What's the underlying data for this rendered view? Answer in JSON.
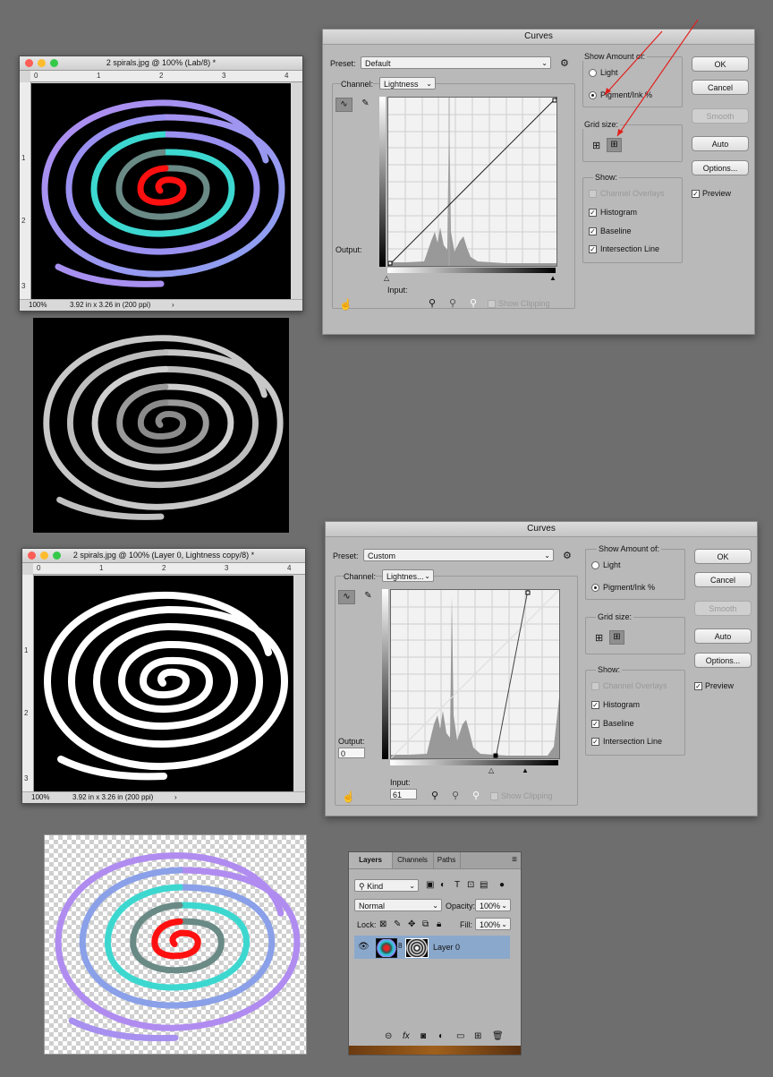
{
  "window1": {
    "title": "2 spirals.jpg @ 100% (Lab/8) *",
    "zoom": "100%",
    "doc_size": "3.92 in x 3.26 in (200 ppi)",
    "ruler_top": [
      "0",
      "1",
      "2",
      "3",
      "4"
    ],
    "ruler_left": [
      "1",
      "2",
      "3"
    ]
  },
  "window2": {
    "title": "2 spirals.jpg @ 100% (Layer 0, Lightness copy/8) *",
    "zoom": "100%",
    "doc_size": "3.92 in x 3.26 in (200 ppi)",
    "ruler_top": [
      "0",
      "1",
      "2",
      "3",
      "4"
    ],
    "ruler_left": [
      "1",
      "2",
      "3"
    ]
  },
  "curves1": {
    "title": "Curves",
    "preset_label": "Preset:",
    "preset_value": "Default",
    "channel_label": "Channel:",
    "channel_value": "Lightness",
    "output_label": "Output:",
    "input_label": "Input:",
    "show_clipping": "Show Clipping",
    "show_amount_label": "Show Amount of:",
    "light": "Light",
    "pigment": "Pigment/Ink %",
    "grid_size_label": "Grid size:",
    "show_label": "Show:",
    "channel_overlays": "Channel Overlays",
    "histogram": "Histogram",
    "baseline": "Baseline",
    "intersection_line": "Intersection Line",
    "ok": "OK",
    "cancel": "Cancel",
    "smooth": "Smooth",
    "auto": "Auto",
    "options": "Options...",
    "preview": "Preview"
  },
  "curves2": {
    "title": "Curves",
    "preset_label": "Preset:",
    "preset_value": "Custom",
    "channel_label": "Channel:",
    "channel_value": "Lightnes...",
    "output_label": "Output:",
    "output_value": "0",
    "input_label": "Input:",
    "input_value": "61",
    "show_clipping": "Show Clipping",
    "show_amount_label": "Show Amount of:",
    "light": "Light",
    "pigment": "Pigment/Ink %",
    "grid_size_label": "Grid size:",
    "show_label": "Show:",
    "channel_overlays": "Channel Overlays",
    "histogram": "Histogram",
    "baseline": "Baseline",
    "intersection_line": "Intersection Line",
    "ok": "OK",
    "cancel": "Cancel",
    "smooth": "Smooth",
    "auto": "Auto",
    "options": "Options...",
    "preview": "Preview"
  },
  "layers": {
    "tabs": [
      "Layers",
      "Channels",
      "Paths"
    ],
    "filter_kind": "Kind",
    "blend_mode": "Normal",
    "opacity_label": "Opacity:",
    "opacity_value": "100%",
    "lock_label": "Lock:",
    "fill_label": "Fill:",
    "fill_value": "100%",
    "layer_name": "Layer 0",
    "bottom_fx": "fx"
  },
  "colors": {
    "arrow": "#e0201c",
    "spiral_outer": "#b08cf0",
    "spiral_mid": "#3cd8d0",
    "spiral_inner": "#ff1010",
    "selected_layer": "#8aa8cc"
  }
}
